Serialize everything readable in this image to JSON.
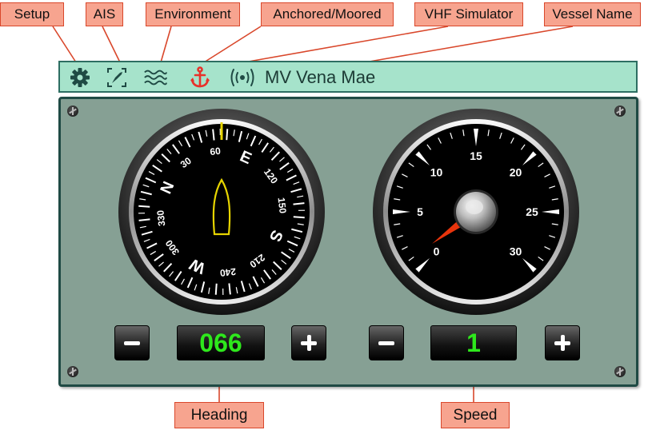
{
  "callouts": {
    "setup": "Setup",
    "ais": "AIS",
    "environment": "Environment",
    "anchored": "Anchored/Moored",
    "vhf": "VHF Simulator",
    "vessel_name": "Vessel Name",
    "heading": "Heading",
    "speed": "Speed"
  },
  "toolbar": {
    "vessel_name": "MV Vena Mae",
    "icons": [
      "gear-icon",
      "ais-icon",
      "waves-icon",
      "anchor-icon",
      "radio-broadcast-icon"
    ],
    "anchor_color": "#e8312a",
    "icon_color": "#1f4a44"
  },
  "heading": {
    "value": "066",
    "decrement_label": "−",
    "increment_label": "+",
    "dial_cardinals": [
      "N",
      "E",
      "S",
      "W"
    ],
    "dial_numbers": [
      "30",
      "60",
      "120",
      "150",
      "210",
      "240",
      "300",
      "330"
    ]
  },
  "speed": {
    "value": "1",
    "decrement_label": "−",
    "increment_label": "+",
    "dial_labels": [
      "0",
      "5",
      "10",
      "15",
      "20",
      "25",
      "30"
    ],
    "needle_color": "#e8340c"
  },
  "colors": {
    "toolbar_bg": "#a6e3cb",
    "panel_bg": "#86a094",
    "display_text": "#2ee81c",
    "boat_outline": "#e6d400"
  }
}
